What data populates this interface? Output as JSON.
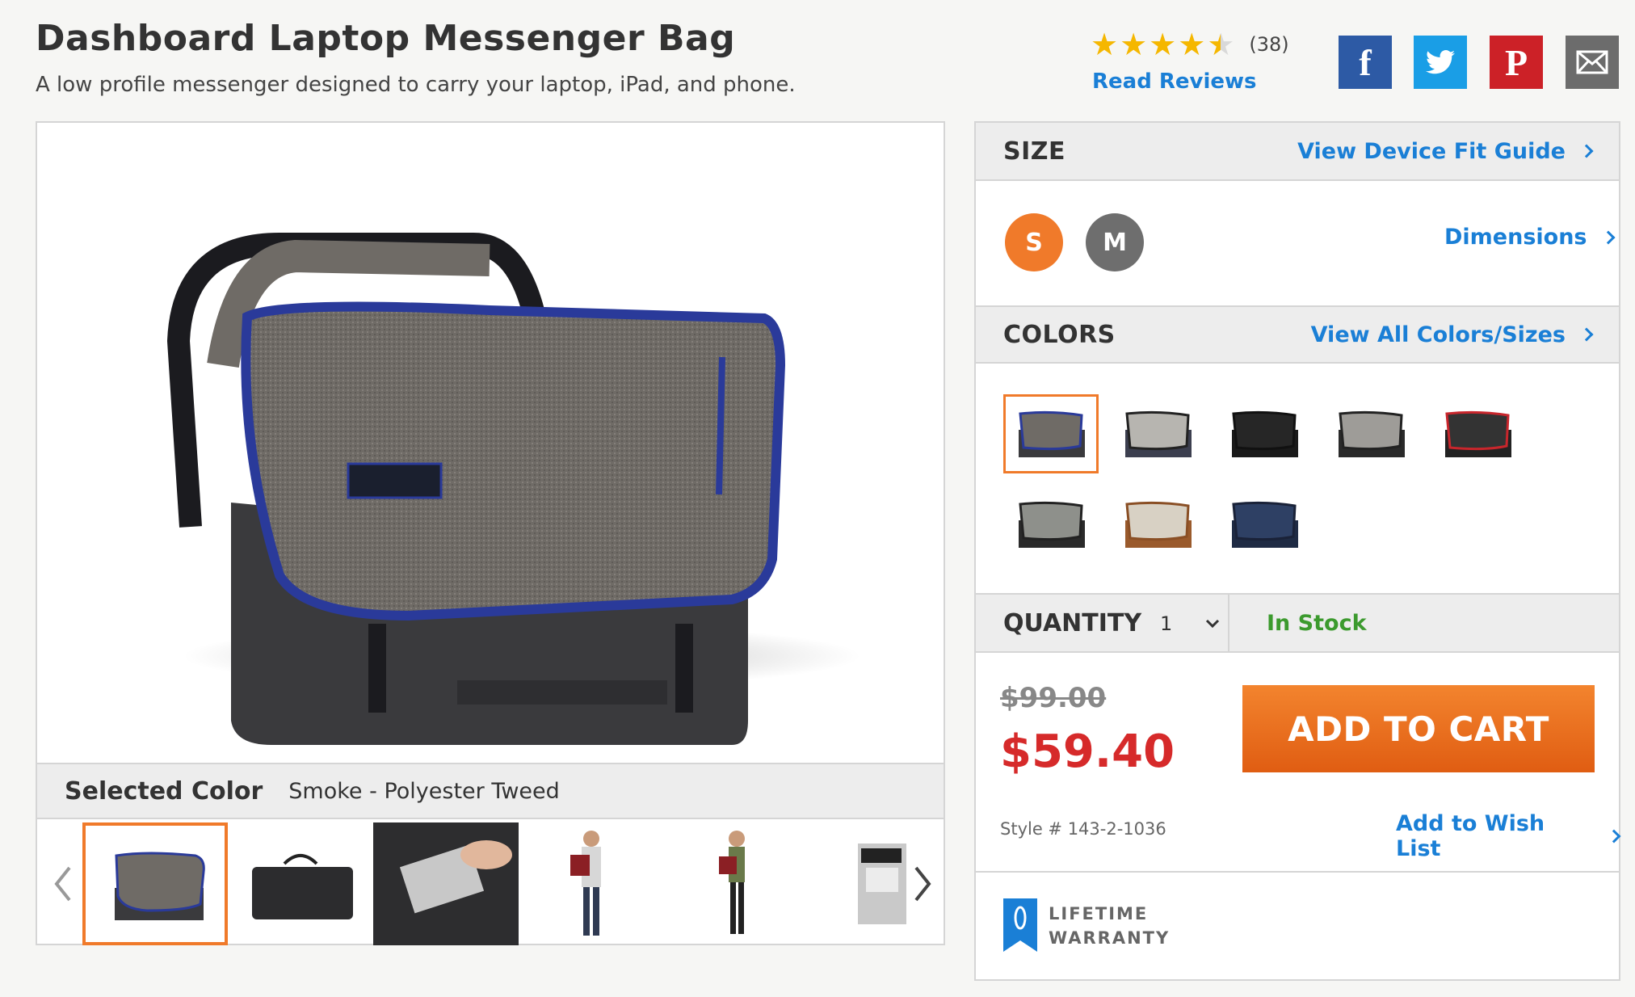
{
  "header": {
    "title": "Dashboard Laptop Messenger Bag",
    "subtitle": "A low profile messenger designed to carry your laptop, iPad, and phone.",
    "rating": {
      "stars": 4.5,
      "count_label": "(38)",
      "read_reviews_label": "Read Reviews"
    },
    "share": [
      "facebook-icon",
      "twitter-icon",
      "pinterest-icon",
      "email-icon"
    ],
    "share_colors": {
      "facebook": "#2d5aa5",
      "twitter": "#1a9ee6",
      "pinterest": "#cc2127",
      "email": "#6c6c6c"
    }
  },
  "gallery": {
    "selected_color_label": "Selected Color",
    "selected_color_value": "Smoke - Polyester Tweed",
    "thumbnails": [
      "bag-front",
      "bag-back",
      "bag-laptop-sleeve",
      "model-man-back",
      "model-woman-front",
      "bag-interior"
    ],
    "active_thumbnail": 0
  },
  "options": {
    "size": {
      "title": "SIZE",
      "link_label": "View Device Fit Guide",
      "dimensions_label": "Dimensions",
      "sizes": [
        "S",
        "M"
      ],
      "selected": "S"
    },
    "colors": {
      "title": "COLORS",
      "link_label": "View All Colors/Sizes",
      "swatch_count": 8,
      "selected_index": 0
    },
    "quantity": {
      "label": "QUANTITY",
      "value": "1",
      "stock_label": "In Stock"
    },
    "price": {
      "old": "$99.00",
      "current": "$59.40",
      "add_to_cart_label": "ADD TO CART",
      "style_label": "Style # 143-2-1036",
      "wishlist_label": "Add to Wish List"
    },
    "warranty": {
      "line1": "LIFETIME",
      "line2": "WARRANTY"
    }
  },
  "colors": {
    "accent_orange": "#f07a2a",
    "link_blue": "#1a7fd6",
    "sale_red": "#d62a2a",
    "in_stock_green": "#3c9a2e"
  }
}
